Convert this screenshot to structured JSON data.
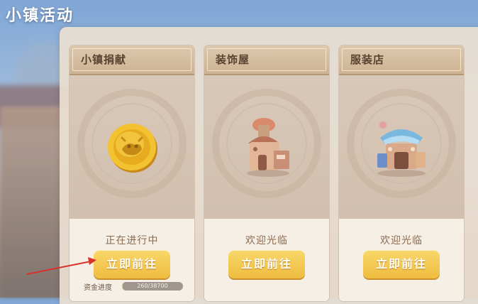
{
  "title": "小镇活动",
  "cards": [
    {
      "name": "小镇捐献",
      "status": "正在进行中",
      "button": "立即前往",
      "icon": "gold-coin-icon"
    },
    {
      "name": "装饰屋",
      "status": "欢迎光临",
      "button": "立即前往",
      "icon": "decoration-house-icon"
    },
    {
      "name": "服装店",
      "status": "欢迎光临",
      "button": "立即前往",
      "icon": "clothing-shop-icon"
    }
  ],
  "funding": {
    "label": "资金进度",
    "text": "260/38700",
    "progress": 0.0067
  },
  "colors": {
    "button": "#f0c043",
    "status": "#8b6b50",
    "header": "#d6bf9f",
    "title": "#ffffff"
  }
}
